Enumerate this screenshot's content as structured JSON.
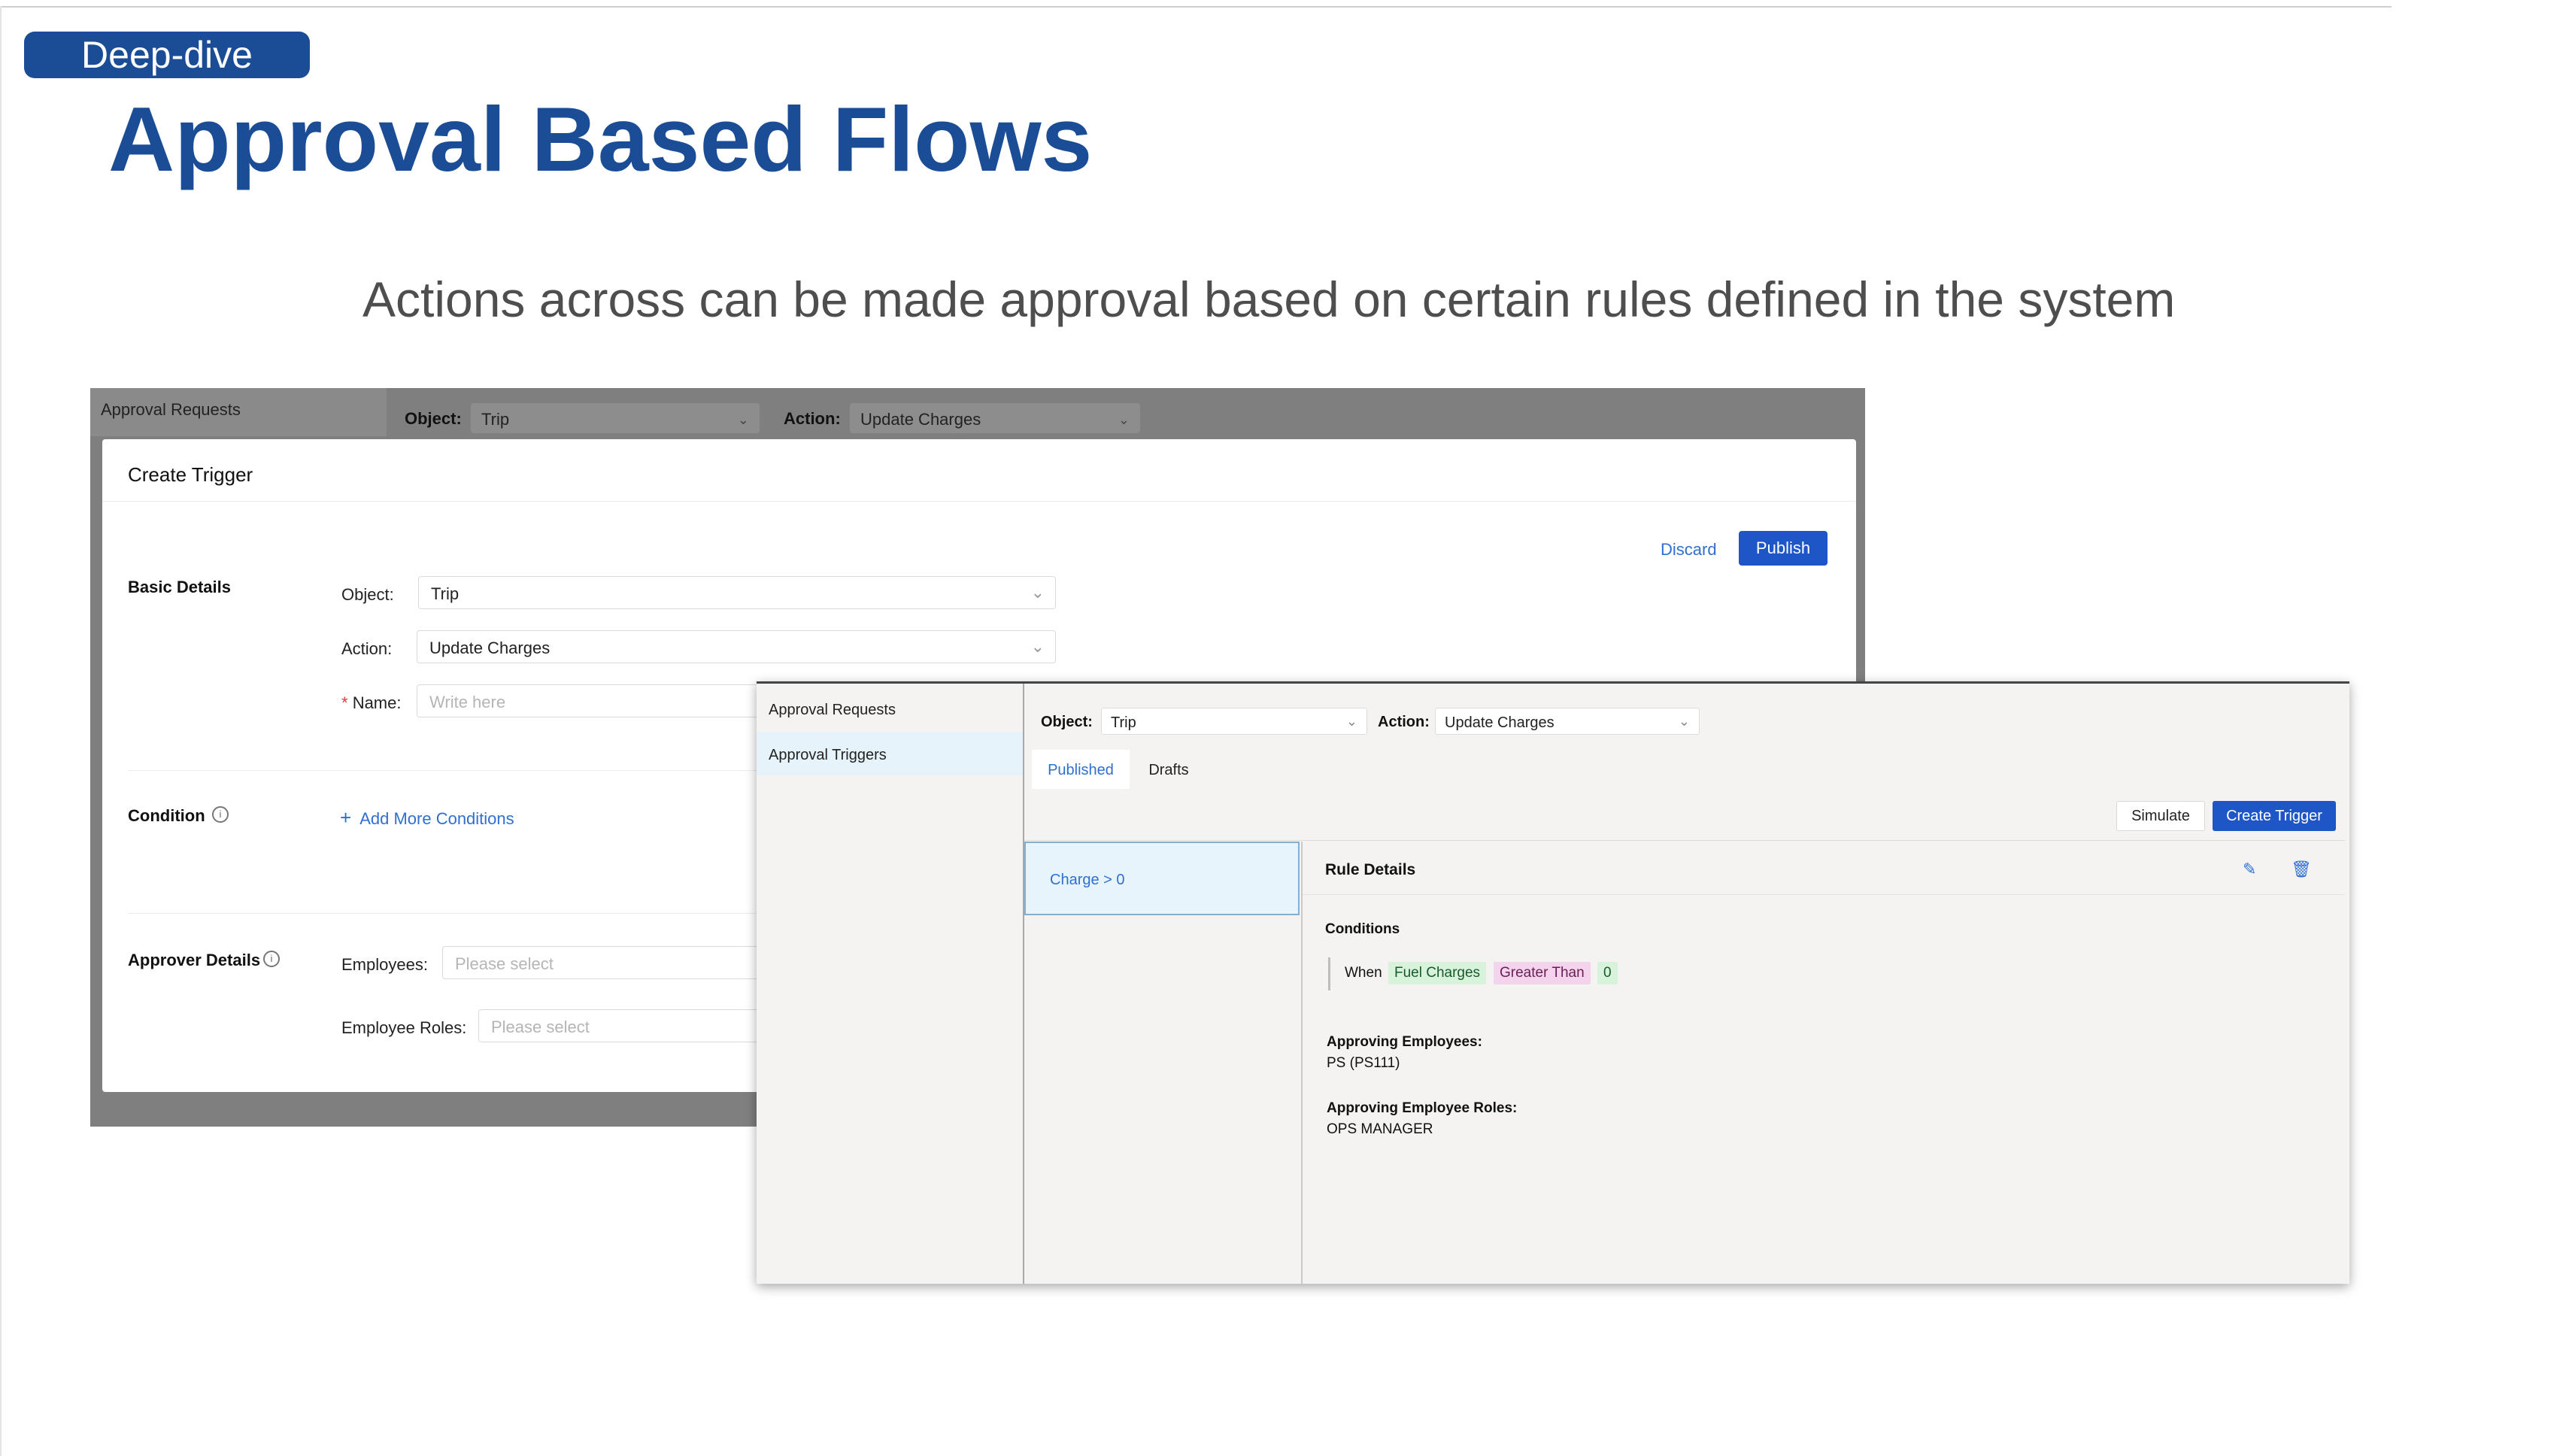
{
  "slide": {
    "tag": "Deep-dive",
    "title": "Approval Based Flows",
    "subtitle": "Actions across can be made approval based on certain rules defined in the system",
    "colors": {
      "brand": "#1b4d96",
      "primary": "#1e56c8",
      "link": "#2f6fd1"
    }
  },
  "screen1": {
    "nav_label": "Approval Requests",
    "object_label": "Object:",
    "object_value": "Trip",
    "action_label": "Action:",
    "action_value": "Update Charges",
    "card_title": "Create Trigger",
    "discard": "Discard",
    "publish": "Publish",
    "basic_details": "Basic Details",
    "object_field_label": "Object:",
    "object_field_value": "Trip",
    "action_field_label": "Action:",
    "action_field_value": "Update Charges",
    "name_required": "*",
    "name_label": "Name",
    "name_colon": ":",
    "name_placeholder": "Write here",
    "condition": "Condition",
    "add_conditions": "Add More Conditions",
    "approver_details": "Approver Details",
    "employees_label": "Employees",
    "employees_placeholder": "Please select",
    "employee_roles_label": "Employee Roles",
    "employee_roles_placeholder": "Please select",
    "colon": ":"
  },
  "screen2": {
    "sidebar": [
      "Approval Requests",
      "Approval Triggers"
    ],
    "object_label": "Object:",
    "object_value": "Trip",
    "action_label": "Action:",
    "action_value": "Update Charges",
    "tabs": [
      "Published",
      "Drafts"
    ],
    "simulate": "Simulate",
    "create_trigger": "Create Trigger",
    "rule": "Charge > 0",
    "rule_details": "Rule Details",
    "conditions_heading": "Conditions",
    "when": "When",
    "chips": [
      "Fuel Charges",
      "Greater Than",
      "0"
    ],
    "approving_employees_label": "Approving Employees:",
    "approving_employees_value": "PS (PS111)",
    "approving_roles_label": "Approving Employee Roles:",
    "approving_roles_value": "OPS MANAGER",
    "icons": [
      "edit-icon",
      "delete-icon"
    ]
  }
}
